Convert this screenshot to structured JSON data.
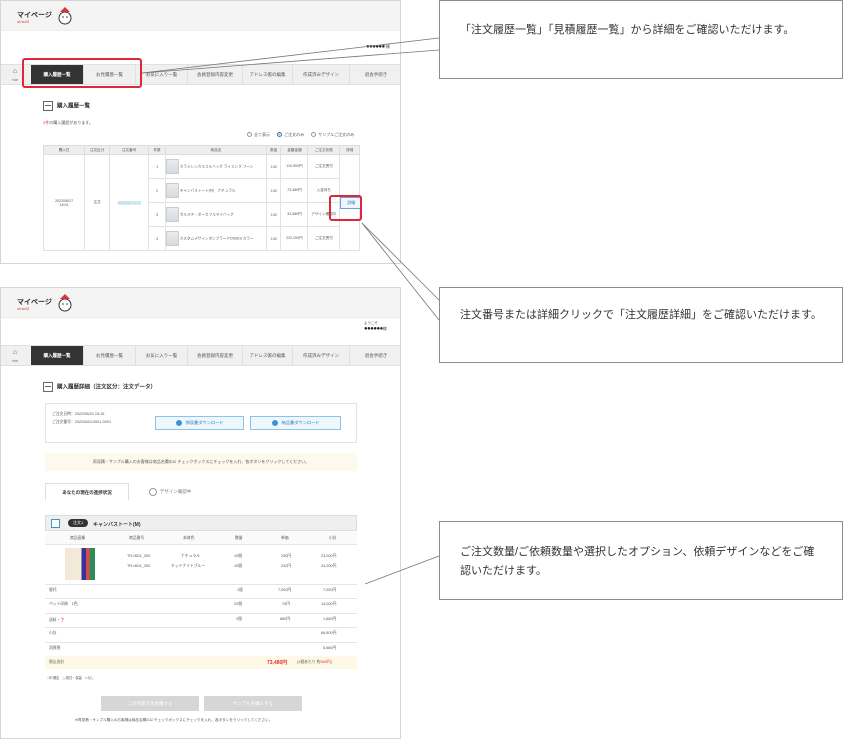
{
  "brand": {
    "mypage": "マイページ",
    "sub": "ok ku02"
  },
  "user": {
    "greeting": "ようこそ",
    "name": "●●●●●●",
    "suffix": "様"
  },
  "nav": {
    "home_label": "TOP",
    "tabs": [
      "購入履歴一覧",
      "お見積歴一覧",
      "お気に入り一覧",
      "会員登録内容変更",
      "アドレス帳の編集",
      "作成済みデザイン",
      "退会手続き"
    ]
  },
  "orders": {
    "title": "購入履歴一覧",
    "count_num": "2件",
    "count_rest": "の購入履歴があります。",
    "filters": [
      "全て表示",
      "ご注文のみ",
      "サンプルご注文のみ"
    ],
    "filter_selected": "ご注文のみ",
    "headers": [
      "購入日",
      "注文区分",
      "注文番号",
      "件数",
      "商品名",
      "数量",
      "金額金額",
      "ご注文状態",
      "詳細"
    ],
    "date": "2022/06/27\n18:01",
    "type": "注文",
    "number": "20220627-123",
    "items": [
      {
        "no": "1",
        "name": "カラミレシカルコルハッグ ライミング  フーン",
        "qty": "100",
        "amount": "110,900円",
        "status": "ご注文受付"
      },
      {
        "no": "2",
        "name": "キャンバストート(M)　ナチュラル",
        "qty": "100",
        "amount": "73,480円",
        "status": "入金待ち"
      },
      {
        "no": "3",
        "name": "セルスチ・ポーカフルマイバッグ",
        "qty": "100",
        "amount": "33,980円",
        "status": "デザイン確認中"
      },
      {
        "no": "4",
        "name": "カスタムデザインタンブラー POSSEd カラー",
        "qty": "100",
        "amount": "222,200円",
        "status": "ご注文受付"
      }
    ],
    "detail_label": "詳細"
  },
  "callouts": {
    "c1": "「注文履歴一覧」「見積履歴一覧」から詳細をご確認いただけます。",
    "c2": "注文番号または詳細クリックで「注文履歴詳細」をご確認いただけます。",
    "c3": "ご注文数量/ご依頼数量や選択したオプション、依頼デザインなどをご確認いただけます。"
  },
  "detail": {
    "title": "購入履歴詳細（注文区分：注文データ）",
    "order_date_label": "ご注文日時：",
    "order_date": "2022/06/24 15:16",
    "order_no_label": "ご注文番号：",
    "order_no": "20220624-0001-0001",
    "quote_btn": "領収書ダウンロード",
    "delivery_btn": "納品書ダウンロード",
    "notice": "再見積・サンプル購入のお客様は商品名欄の☑ チェックボックスにチェックを入れ、各ボタンをクリックしてください。",
    "tab_status": "あなたの現在の進捗状況",
    "tab_design": "デザイン確認中",
    "item_badge": "注文1",
    "item_name": "キャンバストート(M)",
    "item_cols": [
      "商品画像",
      "商品番号",
      "本体色",
      "数量",
      "単価",
      "小計"
    ],
    "item_rows": [
      {
        "code": "TR-0601_300",
        "color": "ナチュラル",
        "qty": "10個",
        "unit": "230円",
        "sub": "23,000円"
      },
      {
        "code": "TR-0601_300",
        "color": "ミッドナイトブルー",
        "qty": "10個",
        "unit": "242円",
        "sub": "24,200円"
      }
    ],
    "lines": [
      {
        "label": "版代",
        "qty": "1版",
        "unit": "7,000円",
        "sub": "7,000円"
      },
      {
        "label": "ペット印刷　1色",
        "qty": "20個",
        "unit": "70円",
        "sub": "14,000円"
      },
      {
        "label": "送料・❓",
        "qty": "2個",
        "unit": "880円",
        "sub": "1,660円"
      },
      {
        "label": "小計",
        "qty": "",
        "unit": "",
        "sub": "66,800円"
      },
      {
        "label": "消費税",
        "qty": "",
        "unit": "",
        "sub": "6,680円"
      }
    ],
    "total_label": "税込合計",
    "total_value": "73,480円",
    "total_note_pre": "(1個あたり 約",
    "total_note_red": "368円",
    "total_note_post": ")",
    "legend": "○印:確定　△:検討・保留　×:なし",
    "reorder_btn": "この内容で再見積する",
    "sample_btn": "サンプルを購入する",
    "footer_note": "※再見積・サンプル購入のお客様は商品名欄の☑ チェックボックスにチェックを入れ、各ボタンをクリックしてください。"
  }
}
